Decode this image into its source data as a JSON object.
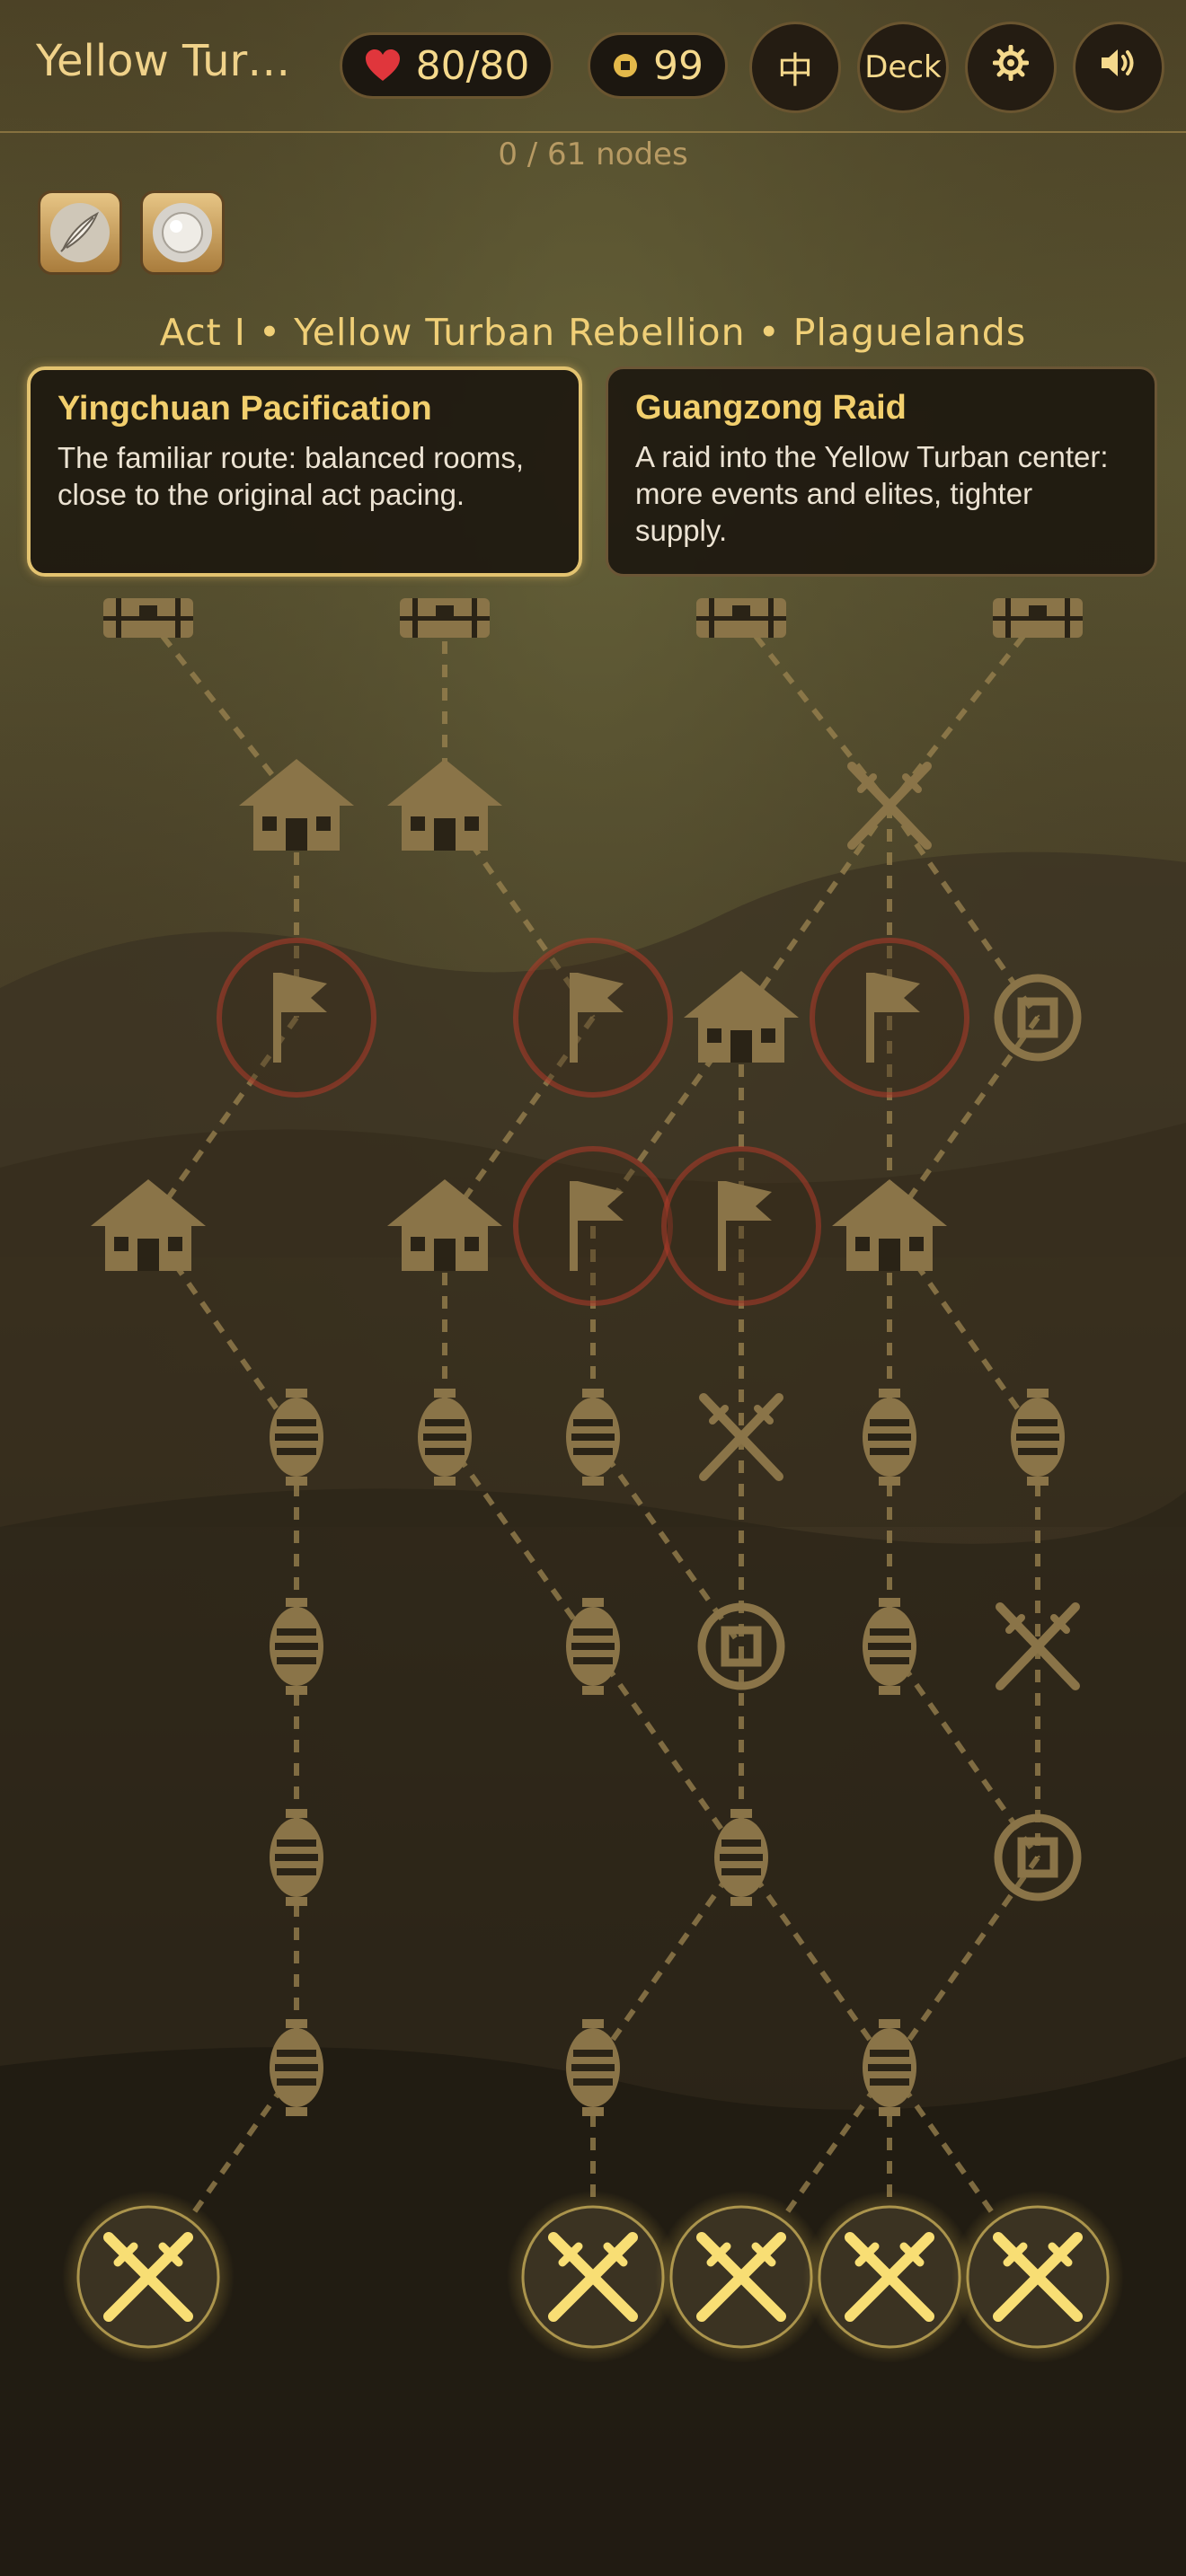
{
  "header": {
    "title": "Yellow Tur…",
    "hp": "80/80",
    "gold": "99",
    "lang_button": "中",
    "deck_button": "Deck",
    "heart_icon": "heart-icon",
    "coin_icon": "coin-icon",
    "settings_icon": "gear-icon",
    "sound_icon": "speaker-icon"
  },
  "progress": "0 / 61 nodes",
  "relics": [
    {
      "name": "feather-relic-icon"
    },
    {
      "name": "pearl-relic-icon"
    }
  ],
  "act_title": "Act I • Yellow Turban Rebellion • Plaguelands",
  "routes": [
    {
      "title": "Yingchuan Pacification",
      "desc": "The familiar route: balanced rooms, close to the original act pacing.",
      "selected": true
    },
    {
      "title": "Guangzong Raid",
      "desc": "A raid into the Yellow Turban center: more events and elites, tighter supply.",
      "selected": false
    }
  ],
  "colors": {
    "accent": "#f0cf77",
    "node_dim": "#8a7448",
    "node_active": "#f8de74",
    "elite_glow": "#c0392b",
    "panel": "#1c1610"
  },
  "map_nodes": [
    {
      "id": "c0",
      "type": "chest",
      "col": 0,
      "row": 0
    },
    {
      "id": "c1",
      "type": "chest",
      "col": 2,
      "row": 0
    },
    {
      "id": "c2",
      "type": "chest",
      "col": 4,
      "row": 0
    },
    {
      "id": "c3",
      "type": "chest",
      "col": 6,
      "row": 0
    },
    {
      "id": "r1a",
      "type": "rest",
      "col": 1,
      "row": 1
    },
    {
      "id": "r1b",
      "type": "rest",
      "col": 2,
      "row": 1
    },
    {
      "id": "r1c",
      "type": "battle",
      "col": 5,
      "row": 1
    },
    {
      "id": "r2a",
      "type": "elite",
      "col": 1,
      "row": 2
    },
    {
      "id": "r2b",
      "type": "elite",
      "col": 3,
      "row": 2
    },
    {
      "id": "r2c",
      "type": "rest",
      "col": 4,
      "row": 2
    },
    {
      "id": "r2d",
      "type": "elite",
      "col": 5,
      "row": 2
    },
    {
      "id": "r2e",
      "type": "shop",
      "col": 6,
      "row": 2
    },
    {
      "id": "r3a",
      "type": "rest",
      "col": 0,
      "row": 3
    },
    {
      "id": "r3b",
      "type": "rest",
      "col": 2,
      "row": 3
    },
    {
      "id": "r3c",
      "type": "elite",
      "col": 3,
      "row": 3
    },
    {
      "id": "r3d",
      "type": "elite",
      "col": 4,
      "row": 3
    },
    {
      "id": "r3e",
      "type": "rest",
      "col": 5,
      "row": 3
    },
    {
      "id": "r4a",
      "type": "event",
      "col": 1,
      "row": 4
    },
    {
      "id": "r4b",
      "type": "event",
      "col": 2,
      "row": 4
    },
    {
      "id": "r4c",
      "type": "event",
      "col": 3,
      "row": 4
    },
    {
      "id": "r4d",
      "type": "battle",
      "col": 4,
      "row": 4
    },
    {
      "id": "r4e",
      "type": "event",
      "col": 5,
      "row": 4
    },
    {
      "id": "r4f",
      "type": "event",
      "col": 6,
      "row": 4
    },
    {
      "id": "r5a",
      "type": "event",
      "col": 1,
      "row": 5
    },
    {
      "id": "r5b",
      "type": "event",
      "col": 3,
      "row": 5
    },
    {
      "id": "r5c",
      "type": "shop",
      "col": 4,
      "row": 5
    },
    {
      "id": "r5d",
      "type": "event",
      "col": 5,
      "row": 5
    },
    {
      "id": "r5e",
      "type": "battle",
      "col": 6,
      "row": 5
    },
    {
      "id": "r6a",
      "type": "event",
      "col": 1,
      "row": 6
    },
    {
      "id": "r6b",
      "type": "event",
      "col": 4,
      "row": 6
    },
    {
      "id": "r6c",
      "type": "shop",
      "col": 6,
      "row": 6
    },
    {
      "id": "r7a",
      "type": "event",
      "col": 1,
      "row": 7
    },
    {
      "id": "r7b",
      "type": "event",
      "col": 3,
      "row": 7
    },
    {
      "id": "r7c",
      "type": "event",
      "col": 5,
      "row": 7
    },
    {
      "id": "s0",
      "type": "start",
      "col": 0,
      "row": 8
    },
    {
      "id": "s1",
      "type": "start",
      "col": 3,
      "row": 8
    },
    {
      "id": "s2",
      "type": "start",
      "col": 4,
      "row": 8
    },
    {
      "id": "s3",
      "type": "start",
      "col": 5,
      "row": 8
    },
    {
      "id": "s4",
      "type": "start",
      "col": 6,
      "row": 8
    }
  ],
  "map_edges": [
    [
      "c0",
      "r1a"
    ],
    [
      "c1",
      "r1b"
    ],
    [
      "c2",
      "r1c"
    ],
    [
      "c3",
      "r1c"
    ],
    [
      "r1a",
      "r2a"
    ],
    [
      "r1b",
      "r2b"
    ],
    [
      "r1c",
      "r2c"
    ],
    [
      "r1c",
      "r2d"
    ],
    [
      "r1c",
      "r2e"
    ],
    [
      "r2a",
      "r3a"
    ],
    [
      "r2b",
      "r3b"
    ],
    [
      "r2c",
      "r3c"
    ],
    [
      "r2c",
      "r3d"
    ],
    [
      "r2d",
      "r3e"
    ],
    [
      "r2e",
      "r3e"
    ],
    [
      "r3a",
      "r4a"
    ],
    [
      "r3b",
      "r4b"
    ],
    [
      "r3c",
      "r4c"
    ],
    [
      "r3d",
      "r4d"
    ],
    [
      "r3e",
      "r4e"
    ],
    [
      "r3e",
      "r4f"
    ],
    [
      "r4a",
      "r5a"
    ],
    [
      "r4b",
      "r5b"
    ],
    [
      "r4c",
      "r5c"
    ],
    [
      "r4d",
      "r5c"
    ],
    [
      "r4e",
      "r5d"
    ],
    [
      "r4f",
      "r5e"
    ],
    [
      "r5a",
      "r6a"
    ],
    [
      "r5b",
      "r6b"
    ],
    [
      "r5c",
      "r6b"
    ],
    [
      "r5d",
      "r6c"
    ],
    [
      "r5e",
      "r6c"
    ],
    [
      "r6a",
      "r7a"
    ],
    [
      "r6b",
      "r7b"
    ],
    [
      "r6b",
      "r7c"
    ],
    [
      "r6c",
      "r7c"
    ],
    [
      "r7a",
      "s0"
    ],
    [
      "r7b",
      "s1"
    ],
    [
      "r7c",
      "s2"
    ],
    [
      "r7c",
      "s3"
    ],
    [
      "r7c",
      "s4"
    ]
  ]
}
